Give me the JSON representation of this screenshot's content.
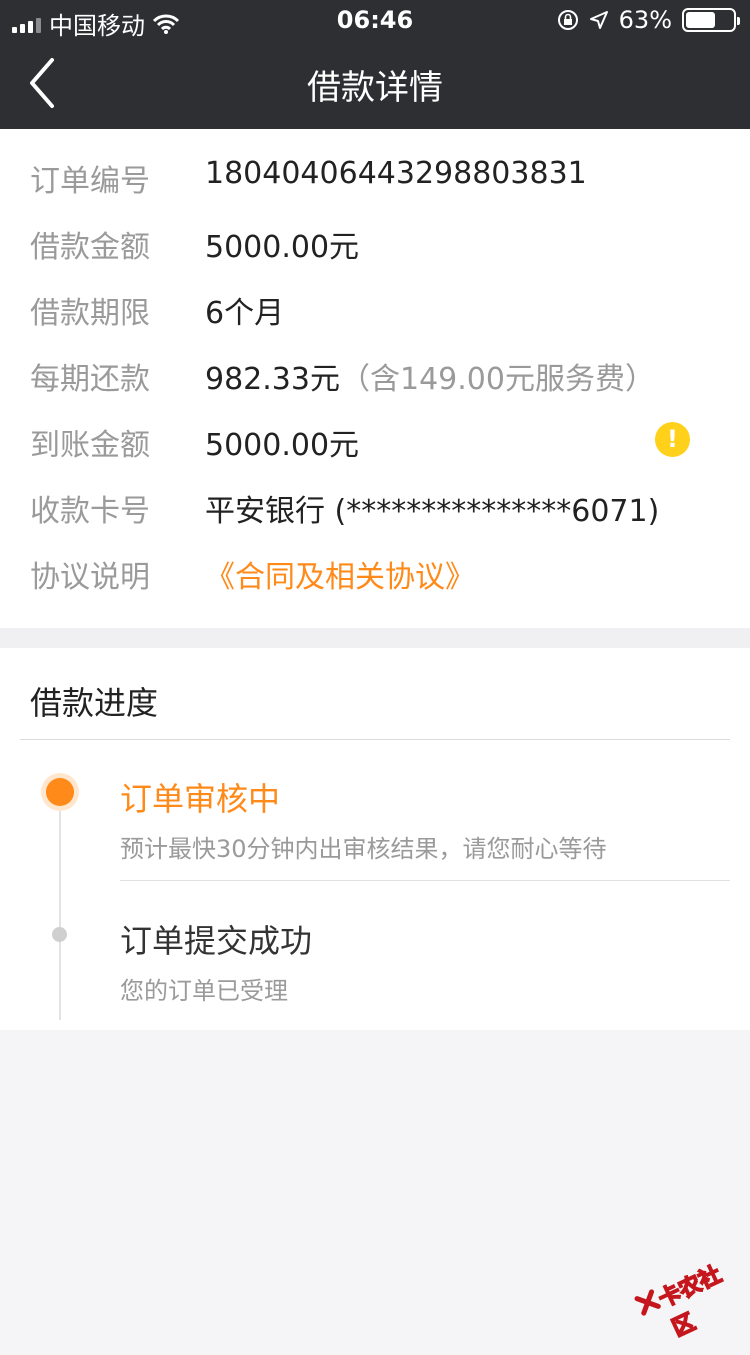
{
  "status_bar": {
    "carrier": "中国移动",
    "time": "06:46",
    "battery": "63%",
    "battery_level": 0.63
  },
  "nav": {
    "title": "借款详情"
  },
  "details": [
    {
      "label": "订单编号",
      "value": "18040406443298803831"
    },
    {
      "label": "借款金额",
      "value": "5000.00元"
    },
    {
      "label": "借款期限",
      "value": "6个月"
    },
    {
      "label": "每期还款",
      "value": "982.33元",
      "note": "（含149.00元服务费）"
    },
    {
      "label": "到账金额",
      "value": "5000.00元"
    },
    {
      "label": "收款卡号",
      "value": "平安银行 (***************6071)"
    },
    {
      "label": "协议说明",
      "value": "《合同及相关协议》"
    }
  ],
  "progress": {
    "title": "借款进度",
    "steps": [
      {
        "title": "订单审核中",
        "desc": "预计最快30分钟内出审核结果，请您耐心等待",
        "active": true
      },
      {
        "title": "订单提交成功",
        "desc": "您的订单已受理",
        "active": false
      }
    ]
  },
  "watermark": "卡农社区",
  "colors": {
    "nav_bg": "#2e2f33",
    "accent": "#ff8a1a",
    "warning": "#ffd11a",
    "label": "#9a9a9a",
    "text": "#222222",
    "bg": "#f5f5f7"
  }
}
